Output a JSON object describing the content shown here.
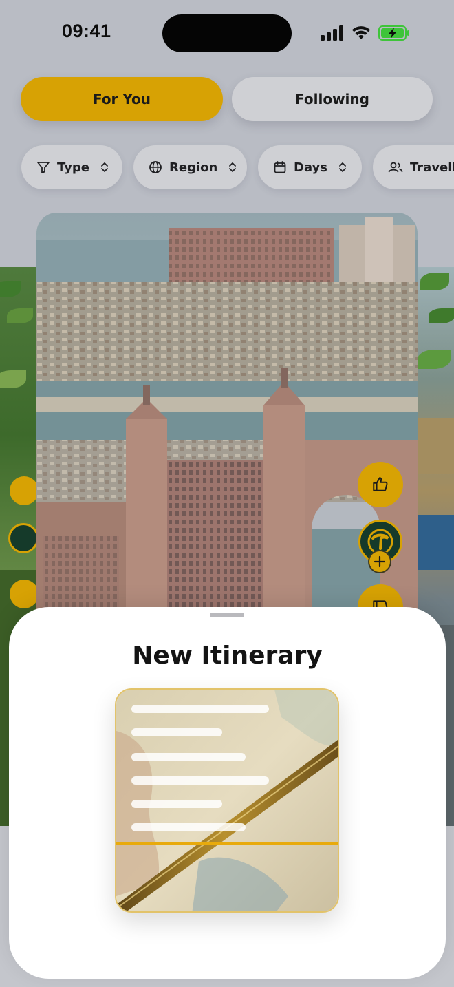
{
  "status_bar": {
    "time": "09:41"
  },
  "tabs": [
    {
      "label": "For You",
      "active": true
    },
    {
      "label": "Following",
      "active": false
    }
  ],
  "filters": [
    {
      "label": "Type",
      "icon": "filter-icon"
    },
    {
      "label": "Region",
      "icon": "globe-icon"
    },
    {
      "label": "Days",
      "icon": "calendar-icon"
    },
    {
      "label": "Travellers",
      "icon": "people-icon"
    }
  ],
  "sheet": {
    "title": "New Itinerary"
  },
  "colors": {
    "accent": "#d7a204",
    "chip_bg": "#cfd0d4",
    "sheet_bg": "#ffffff",
    "scan_line": "#e8aa0c",
    "logo_bg": "#153a2a"
  }
}
